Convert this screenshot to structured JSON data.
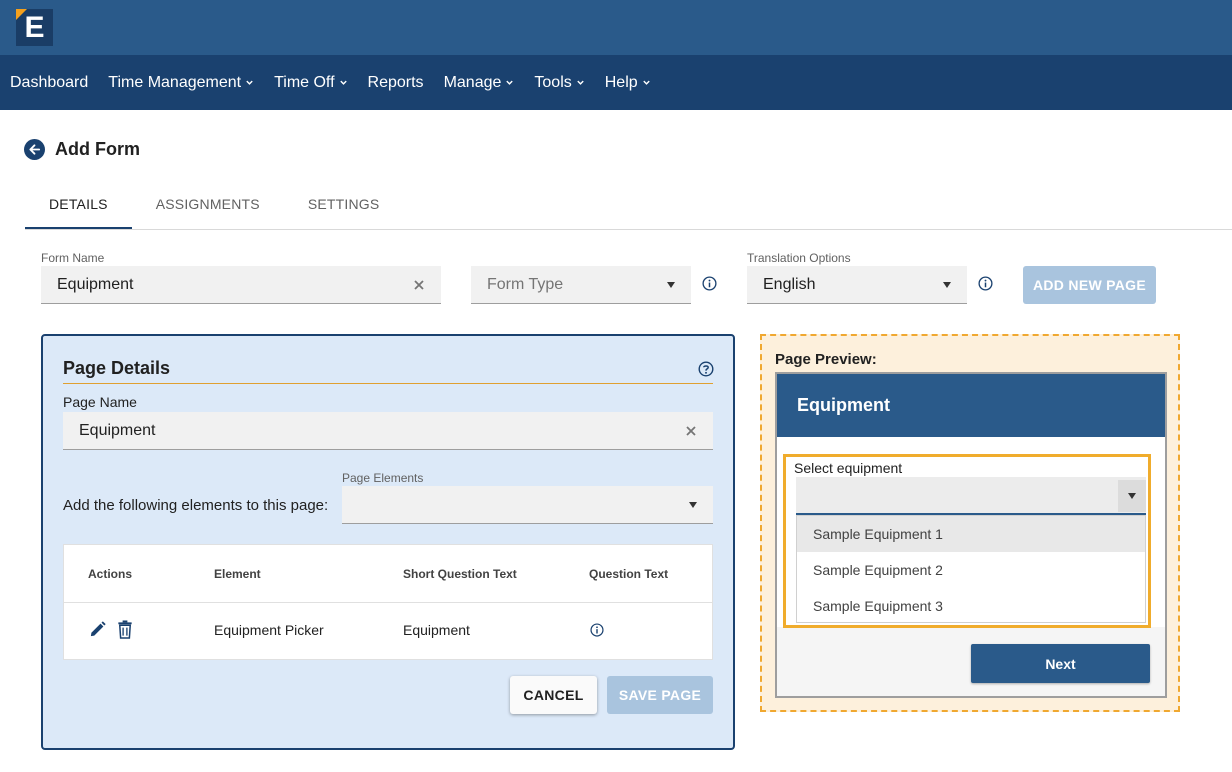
{
  "brand": {
    "logo_letter": "E",
    "logo_color": "#1a3d66",
    "accent_color": "#f4a01c"
  },
  "nav": {
    "items": [
      {
        "label": "Dashboard",
        "dropdown": false
      },
      {
        "label": "Time Management",
        "dropdown": true
      },
      {
        "label": "Time Off",
        "dropdown": true
      },
      {
        "label": "Reports",
        "dropdown": false
      },
      {
        "label": "Manage",
        "dropdown": true
      },
      {
        "label": "Tools",
        "dropdown": true
      },
      {
        "label": "Help",
        "dropdown": true
      }
    ]
  },
  "page": {
    "title": "Add Form"
  },
  "tabs": [
    {
      "label": "DETAILS",
      "active": true
    },
    {
      "label": "ASSIGNMENTS",
      "active": false
    },
    {
      "label": "SETTINGS",
      "active": false
    }
  ],
  "form": {
    "name_label": "Form Name",
    "name_value": "Equipment",
    "type_placeholder": "Form Type",
    "translation_label": "Translation Options",
    "translation_value": "English",
    "add_page_label": "ADD NEW PAGE"
  },
  "page_details": {
    "title": "Page Details",
    "page_name_label": "Page Name",
    "page_name_value": "Equipment",
    "elements_prompt": "Add the following elements to this page:",
    "elements_label": "Page Elements",
    "table": {
      "headers": [
        "Actions",
        "Element",
        "Short Question Text",
        "Question Text"
      ],
      "rows": [
        {
          "element": "Equipment Picker",
          "short_text": "Equipment"
        }
      ]
    },
    "cancel_label": "CANCEL",
    "save_label": "SAVE PAGE"
  },
  "preview": {
    "label": "Page Preview:",
    "card_title": "Equipment",
    "select_label": "Select equipment",
    "options": [
      "Sample Equipment 1",
      "Sample Equipment 2",
      "Sample Equipment 3"
    ],
    "highlighted_option": "Sample Equipment 1",
    "next_label": "Next"
  }
}
